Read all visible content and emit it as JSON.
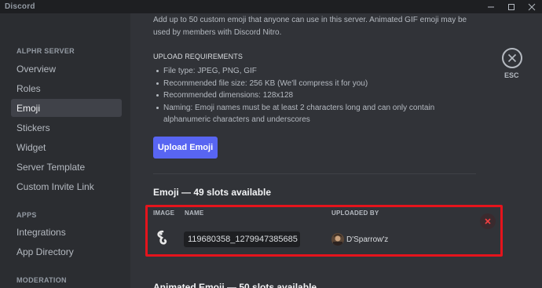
{
  "window": {
    "title": "Discord",
    "controls": [
      "minimize",
      "maximize",
      "close"
    ]
  },
  "sidebar": {
    "sections": [
      {
        "header": "ALPHR SERVER",
        "items": [
          "Overview",
          "Roles",
          "Emoji",
          "Stickers",
          "Widget",
          "Server Template",
          "Custom Invite Link"
        ]
      },
      {
        "header": "APPS",
        "items": [
          "Integrations",
          "App Directory"
        ]
      },
      {
        "header": "MODERATION",
        "items": []
      }
    ],
    "active_item": "Emoji"
  },
  "main": {
    "intro": "Add up to 50 custom emoji that anyone can use in this server. Animated GIF emoji may be used by members with Discord Nitro.",
    "requirements_title": "UPLOAD REQUIREMENTS",
    "requirements": [
      "File type: JPEG, PNG, GIF",
      "Recommended file size: 256 KB (We'll compress it for you)",
      "Recommended dimensions: 128x128",
      "Naming: Emoji names must be at least 2 characters long and can only contain alphanumeric characters and underscores"
    ],
    "upload_button": "Upload Emoji",
    "emoji_heading": "Emoji — 49 slots available",
    "columns": {
      "image": "IMAGE",
      "name": "NAME",
      "uploaded_by": "UPLOADED BY"
    },
    "emoji_row": {
      "name": "119680358_1279947385685",
      "uploaded_by": "D'Sparrow'z",
      "image_icon": "hook-emoji-icon"
    },
    "animated_heading": "Animated Emoji — 50 slots available",
    "close_label": "ESC"
  },
  "colors": {
    "accent": "#5865f2",
    "highlight": "#e5141c",
    "delete": "#f23f42"
  }
}
